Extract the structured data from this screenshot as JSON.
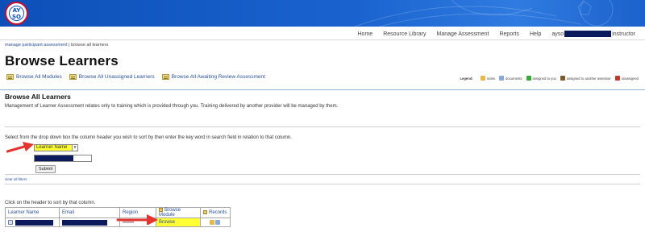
{
  "header": {
    "logo_text_top": "AY",
    "logo_text_bottom": "SO"
  },
  "topnav": {
    "items": [
      "Home",
      "Resource Library",
      "Manage Assessment",
      "Reports",
      "Help"
    ],
    "user_prefix": "ayso",
    "user_suffix": "instructor"
  },
  "breadcrumb": {
    "link": "manage participant assessment",
    "separator": " | ",
    "current": "browse all learners"
  },
  "page_title": "Browse Learners",
  "browse_links": [
    "Browse All Modules",
    "Browse All Unassigned Learners",
    "Browse All Awaiting Review Assessment"
  ],
  "legend": {
    "title": "Legend:",
    "items": [
      {
        "label": "notes",
        "icon": "notes-icon",
        "color": "#e8b84a"
      },
      {
        "label": "documents",
        "icon": "documents-icon",
        "color": "#8aa8d8"
      },
      {
        "label": "assigned to you",
        "icon": "check-icon",
        "color": "#3aa83a"
      },
      {
        "label": "assigned to another assessor",
        "icon": "assessor-icon",
        "color": "#7a5a2a"
      },
      {
        "label": "unassigned",
        "icon": "unassigned-icon",
        "color": "#c0392b"
      }
    ]
  },
  "section": {
    "title": "Browse All Learners",
    "description": "Management of Learner Assessment relates only to training which is provided through you. Training delivered by another provider will be managed by them."
  },
  "search": {
    "instructions": "Select from the drop down box the column header you wish to sort by then enter the key word in search field in relation to that column.",
    "selected_field": "Learner Name",
    "submit_label": "Submit",
    "clear_label": "clear all filters"
  },
  "table": {
    "hint": "Click on the header to sort by that column.",
    "headers": [
      "Learner Name",
      "Email",
      "Region",
      "Browse Module",
      "Records"
    ],
    "rows": [
      {
        "browse_label": "Browse"
      }
    ]
  },
  "colors": {
    "banner": "#1a63cf",
    "highlight": "#ffff33",
    "arrow": "#e3342f",
    "redaction": "#0b1a5c",
    "link": "#2a4f9c"
  }
}
